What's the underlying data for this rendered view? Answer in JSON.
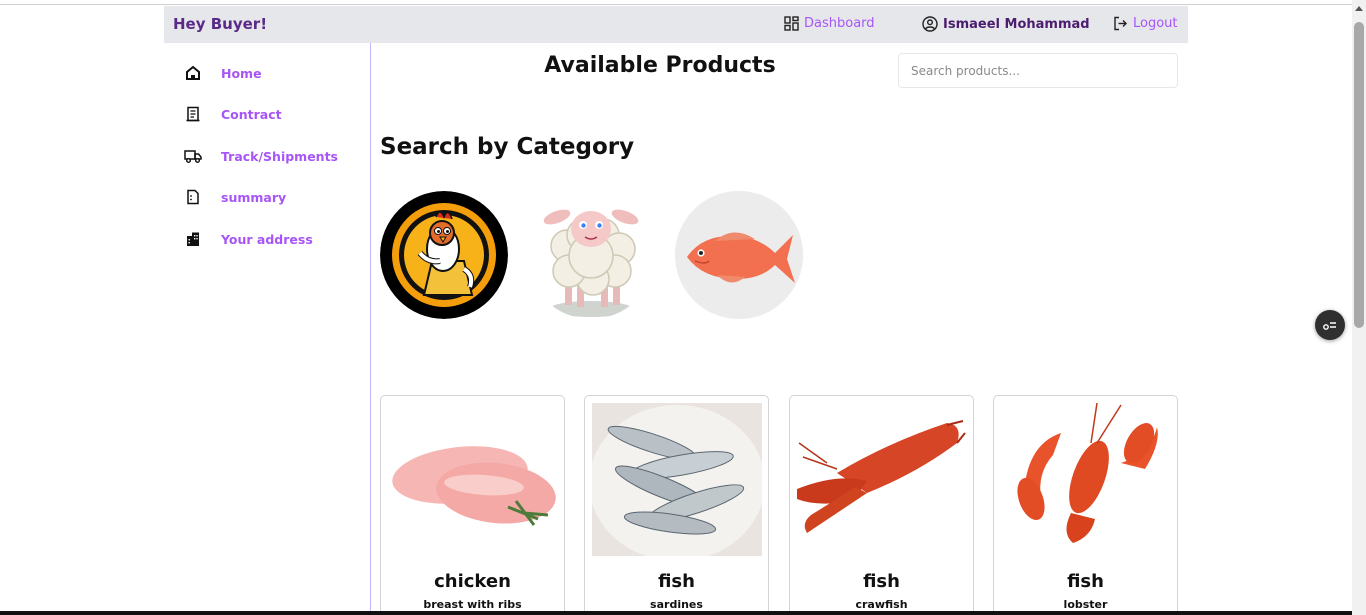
{
  "header": {
    "brand": "Hey Buyer!",
    "dashboard_label": "Dashboard",
    "user_name": "Ismaeel Mohammad",
    "logout_label": "Logout"
  },
  "sidebar": {
    "items": [
      {
        "label": "Home",
        "icon": "home-icon"
      },
      {
        "label": "Contract",
        "icon": "contract-icon"
      },
      {
        "label": "Track/Shipments",
        "icon": "truck-icon"
      },
      {
        "label": "summary",
        "icon": "summary-icon"
      },
      {
        "label": "Your address",
        "icon": "building-icon"
      }
    ]
  },
  "main": {
    "title": "Available Products",
    "search_placeholder": "Search products...",
    "category_heading": "Search by Category",
    "categories": [
      {
        "name": "chicken",
        "icon": "chicken-mascot"
      },
      {
        "name": "sheep",
        "icon": "sheep-cartoon"
      },
      {
        "name": "fish",
        "icon": "red-fish"
      }
    ],
    "products": [
      {
        "name": "chicken",
        "description": "breast with ribs",
        "image": "chicken-breast"
      },
      {
        "name": "fish",
        "description": "sardines",
        "image": "sardines-plate"
      },
      {
        "name": "fish",
        "description": "crawfish",
        "image": "crawfish"
      },
      {
        "name": "fish",
        "description": "lobster",
        "image": "lobster"
      }
    ]
  },
  "colors": {
    "accent": "#a855f7",
    "brand": "#5b2a86",
    "header_bg": "#e5e7eb",
    "divider": "#c4b5fd"
  }
}
